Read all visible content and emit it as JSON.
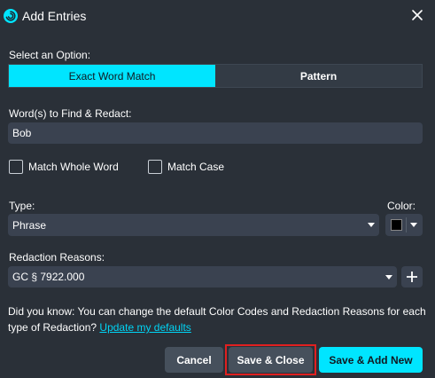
{
  "dialog": {
    "title": "Add Entries",
    "icons": {
      "app": "spiral-logo-icon",
      "close": "close-icon"
    }
  },
  "option": {
    "label": "Select an Option:",
    "choices": [
      "Exact Word Match",
      "Pattern"
    ],
    "selected": "Exact Word Match"
  },
  "words": {
    "label": "Word(s) to Find & Redact:",
    "value": "Bob"
  },
  "checks": {
    "whole_word": {
      "label": "Match Whole Word",
      "checked": false
    },
    "match_case": {
      "label": "Match Case",
      "checked": false
    }
  },
  "type": {
    "label": "Type:",
    "value": "Phrase"
  },
  "color": {
    "label": "Color:",
    "value": "#000000"
  },
  "reasons": {
    "label": "Redaction Reasons:",
    "value": "GC § 7922.000",
    "add_icon": "plus-icon"
  },
  "info": {
    "text": "Did you know: You can change the default Color Codes and Redaction Reasons for each type of Redaction?",
    "link": "Update my defaults"
  },
  "buttons": {
    "cancel": "Cancel",
    "save_close": "Save & Close",
    "save_new": "Save & Add New"
  },
  "colors": {
    "accent": "#00e5ff",
    "background": "#2a3038",
    "field": "#3a4250",
    "highlight": "#e02020"
  }
}
